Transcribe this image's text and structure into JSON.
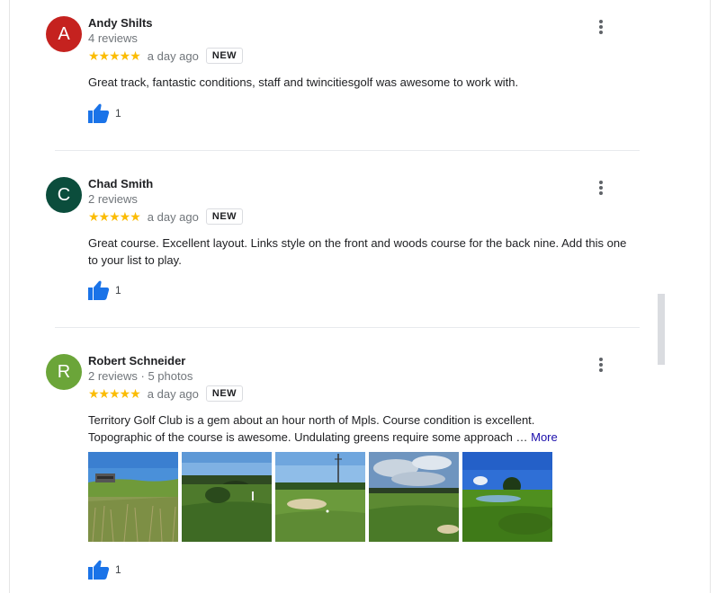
{
  "reviews": [
    {
      "avatar_letter": "A",
      "avatar_color": "#c5221f",
      "name": "Andy Shilts",
      "meta": "4 reviews",
      "stars": "★★★★★",
      "rating": 5,
      "date": "a day ago",
      "badge": "NEW",
      "text": "Great track, fantastic conditions, staff and twincitiesgolf was awesome to work with.",
      "likes": "1"
    },
    {
      "avatar_letter": "C",
      "avatar_color": "#0b4d3c",
      "name": "Chad Smith",
      "meta": "2 reviews",
      "stars": "★★★★★",
      "rating": 5,
      "date": "a day ago",
      "badge": "NEW",
      "text": "Great course. Excellent layout. Links style on the front and woods course for the back nine.  Add this one to your list to play.",
      "likes": "1"
    },
    {
      "avatar_letter": "R",
      "avatar_color": "#6ba539",
      "name": "Robert Schneider",
      "meta": "2 reviews · 5 photos",
      "stars": "★★★★★",
      "rating": 5,
      "date": "a day ago",
      "badge": "NEW",
      "text": "Territory Golf Club is a gem about an hour north of Mpls.  Course condition is excellent. Topographic of the course is awesome.  Undulating greens require some approach …",
      "more_label": "More",
      "likes": "1",
      "photos": [
        "golf-photo-clubhouse",
        "golf-photo-fairway-trees",
        "golf-photo-tower-fairway",
        "golf-photo-cloudy-fairway",
        "golf-photo-pond-green"
      ]
    }
  ],
  "colors": {
    "star": "#fbbc04",
    "like": "#1a73e8",
    "link": "#1a0dab"
  },
  "icons": {
    "like": "thumbs-up-icon",
    "menu": "more-vert-icon"
  }
}
